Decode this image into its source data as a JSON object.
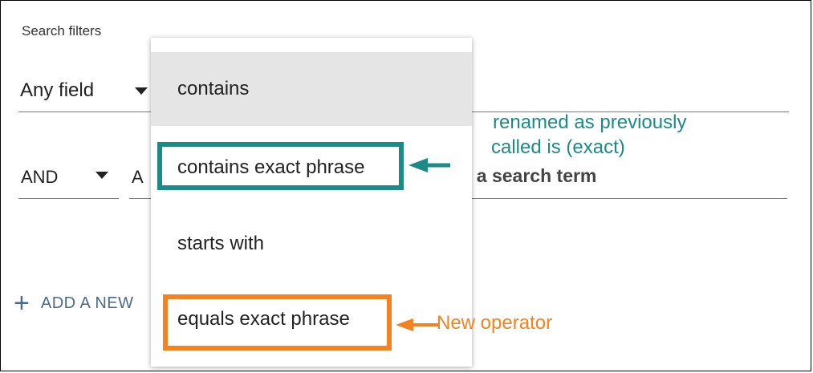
{
  "panel": {
    "title": "Search filters",
    "row1": {
      "field": "Any field"
    },
    "row2": {
      "boolean": "AND",
      "field_partial": "A",
      "term_placeholder_partial": "ter a search term"
    },
    "add_row_label": "ADD A NEW"
  },
  "operator_menu": {
    "items": [
      {
        "label": "contains",
        "selected": true
      },
      {
        "label": "contains exact phrase",
        "selected": false
      },
      {
        "label": "starts with",
        "selected": false
      },
      {
        "label": "equals exact phrase",
        "selected": false
      }
    ]
  },
  "annotations": {
    "renamed_line1": "renamed as previously",
    "renamed_line2": "called is (exact)",
    "new_operator": "New operator"
  },
  "colors": {
    "teal": "#1c8a86",
    "orange": "#f58220",
    "selected_bg": "#e5e5e5",
    "link": "#4b6a86"
  }
}
